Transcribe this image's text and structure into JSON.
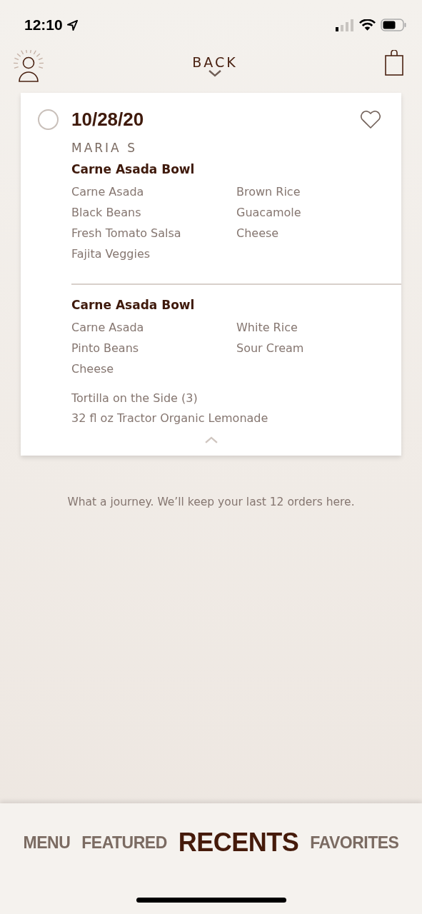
{
  "status_bar": {
    "time": "12:10"
  },
  "header": {
    "back": "BACK"
  },
  "order": {
    "date": "10/28/20",
    "selected": false,
    "favorite": false,
    "name": "MARIA S",
    "entrees": [
      {
        "title": "Carne Asada Bowl",
        "items": [
          "Carne Asada",
          "Black Beans",
          "Fresh Tomato Salsa",
          "Fajita Veggies",
          "Brown Rice",
          "Guacamole",
          "Cheese"
        ]
      },
      {
        "title": "Carne Asada Bowl",
        "items": [
          "Carne Asada",
          "Pinto Beans",
          "Cheese",
          "White Rice",
          "Sour Cream"
        ]
      }
    ],
    "extras": [
      "Tortilla on the Side (3)",
      "32 fl oz Tractor Organic Lemonade"
    ],
    "expanded": true
  },
  "note": "What a journey. We’ll keep your last 12 orders here.",
  "tabs": [
    {
      "label": "MENU",
      "selected": false
    },
    {
      "label": "FEATURED",
      "selected": false
    },
    {
      "label": "RECENTS",
      "selected": true
    },
    {
      "label": "FAVORITES",
      "selected": false
    }
  ]
}
